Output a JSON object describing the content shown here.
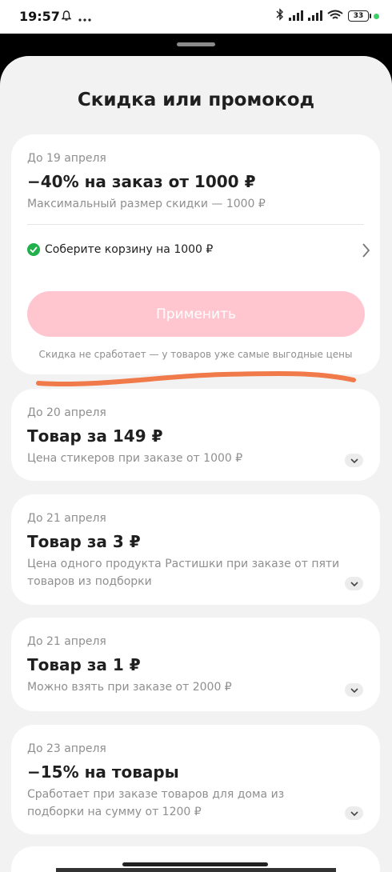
{
  "status": {
    "time": "19:57",
    "battery": "33"
  },
  "sheet": {
    "title": "Скидка или промокод"
  },
  "offer": {
    "date": "До 19 апреля",
    "title": "−40% на заказ от 1000 ₽",
    "desc": "Максимальный размер скидки — 1000 ₽",
    "condition": "Соберите корзину на 1000 ₽",
    "apply_label": "Применить",
    "note": "Скидка не сработает — у товаров уже самые выгодные цены"
  },
  "cards": [
    {
      "date": "До 20 апреля",
      "title": "Товар за 149 ₽",
      "desc": "Цена стикеров при заказе от 1000 ₽"
    },
    {
      "date": "До 21 апреля",
      "title": "Товар за 3 ₽",
      "desc": "Цена одного продукта Растишки при заказе от пяти товаров из подборки"
    },
    {
      "date": "До 21 апреля",
      "title": "Товар за 1 ₽",
      "desc": "Можно взять при заказе от 2000 ₽"
    },
    {
      "date": "До 23 апреля",
      "title": "−15% на товары",
      "desc": "Сработает при заказе товаров для дома из подборки на сумму от 1200 ₽"
    }
  ],
  "colors": {
    "apply_bg": "#ffc6cf",
    "check": "#21b04b",
    "scribble": "#f07a4a"
  }
}
